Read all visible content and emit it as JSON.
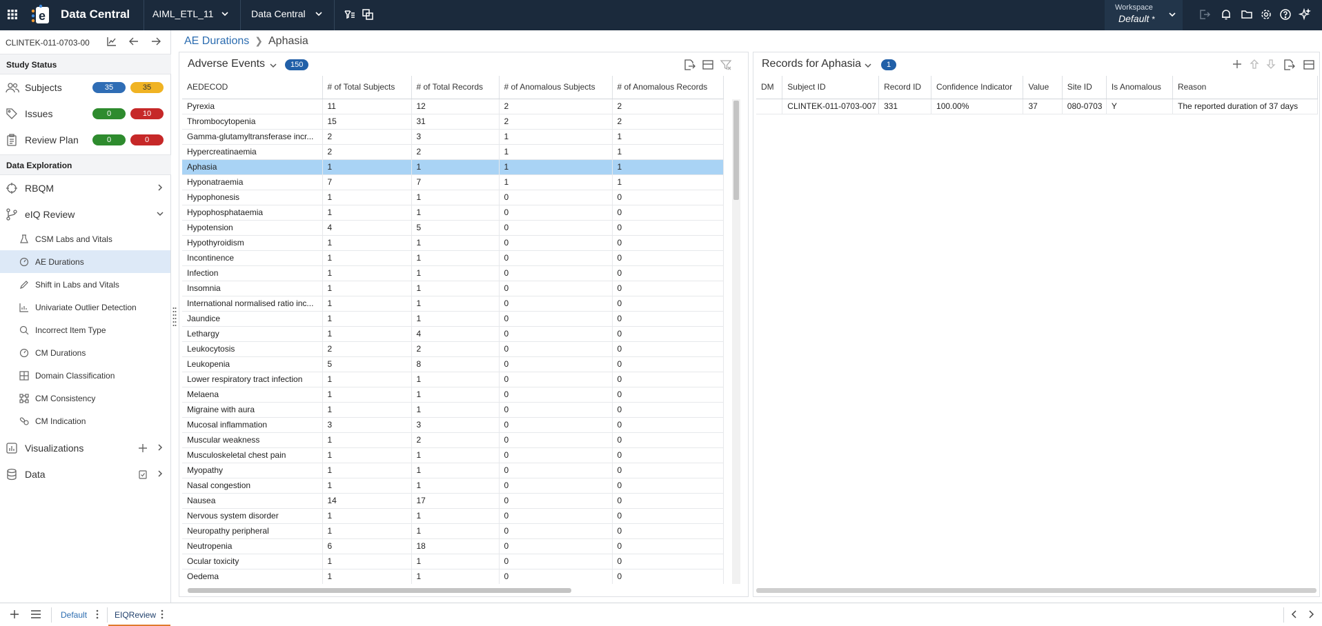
{
  "topbar": {
    "app_title": "Data Central",
    "project": "AIML_ETL_11",
    "module": "Data Central",
    "workspace_label": "Workspace",
    "workspace_value": "Default",
    "workspace_modified": "*"
  },
  "sidebar": {
    "study_id": "CLINTEK-011-0703-00",
    "study_status_header": "Study Status",
    "status_items": [
      {
        "label": "Subjects",
        "left_count": "35",
        "right_count": "35",
        "left_color": "#2f6db5",
        "right_color": "#f0b323"
      },
      {
        "label": "Issues",
        "left_count": "0",
        "right_count": "10",
        "left_color": "#2e8b2e",
        "right_color": "#c62828"
      },
      {
        "label": "Review Plan",
        "left_count": "0",
        "right_count": "0",
        "left_color": "#2e8b2e",
        "right_color": "#c62828"
      }
    ],
    "exploration_header": "Data Exploration",
    "rbqm_label": "RBQM",
    "eiq_label": "eIQ Review",
    "eiq_items": [
      {
        "label": "CSM Labs and Vitals",
        "icon": "flask-icon"
      },
      {
        "label": "AE Durations",
        "icon": "timer-icon"
      },
      {
        "label": "Shift in Labs and Vitals",
        "icon": "pencil-icon"
      },
      {
        "label": "Univariate Outlier Detection",
        "icon": "chart-icon"
      },
      {
        "label": "Incorrect Item Type",
        "icon": "search-icon"
      },
      {
        "label": "CM Durations",
        "icon": "timer-icon"
      },
      {
        "label": "Domain Classification",
        "icon": "grid-icon"
      },
      {
        "label": "CM Consistency",
        "icon": "network-icon"
      },
      {
        "label": "CM Indication",
        "icon": "pills-icon"
      }
    ],
    "active_item": "AE Durations",
    "visualizations_label": "Visualizations",
    "data_label": "Data"
  },
  "breadcrumb": {
    "parent": "AE Durations",
    "current": "Aphasia"
  },
  "left_panel": {
    "title": "Adverse Events",
    "count": "150",
    "columns": [
      "AEDECOD",
      "# of Total Subjects",
      "# of Total Records",
      "# of Anomalous Subjects",
      "# of Anomalous Records"
    ],
    "selected_row": "Aphasia",
    "rows": [
      [
        "Pyrexia",
        "11",
        "12",
        "2",
        "2"
      ],
      [
        "Thrombocytopenia",
        "15",
        "31",
        "2",
        "2"
      ],
      [
        "Gamma-glutamyltransferase incr...",
        "2",
        "3",
        "1",
        "1"
      ],
      [
        "Hypercreatinaemia",
        "2",
        "2",
        "1",
        "1"
      ],
      [
        "Aphasia",
        "1",
        "1",
        "1",
        "1"
      ],
      [
        "Hyponatraemia",
        "7",
        "7",
        "1",
        "1"
      ],
      [
        "Hypophonesis",
        "1",
        "1",
        "0",
        "0"
      ],
      [
        "Hypophosphataemia",
        "1",
        "1",
        "0",
        "0"
      ],
      [
        "Hypotension",
        "4",
        "5",
        "0",
        "0"
      ],
      [
        "Hypothyroidism",
        "1",
        "1",
        "0",
        "0"
      ],
      [
        "Incontinence",
        "1",
        "1",
        "0",
        "0"
      ],
      [
        "Infection",
        "1",
        "1",
        "0",
        "0"
      ],
      [
        "Insomnia",
        "1",
        "1",
        "0",
        "0"
      ],
      [
        "International normalised ratio inc...",
        "1",
        "1",
        "0",
        "0"
      ],
      [
        "Jaundice",
        "1",
        "1",
        "0",
        "0"
      ],
      [
        "Lethargy",
        "1",
        "4",
        "0",
        "0"
      ],
      [
        "Leukocytosis",
        "2",
        "2",
        "0",
        "0"
      ],
      [
        "Leukopenia",
        "5",
        "8",
        "0",
        "0"
      ],
      [
        "Lower respiratory tract infection",
        "1",
        "1",
        "0",
        "0"
      ],
      [
        "Melaena",
        "1",
        "1",
        "0",
        "0"
      ],
      [
        "Migraine with aura",
        "1",
        "1",
        "0",
        "0"
      ],
      [
        "Mucosal inflammation",
        "3",
        "3",
        "0",
        "0"
      ],
      [
        "Muscular weakness",
        "1",
        "2",
        "0",
        "0"
      ],
      [
        "Musculoskeletal chest pain",
        "1",
        "1",
        "0",
        "0"
      ],
      [
        "Myopathy",
        "1",
        "1",
        "0",
        "0"
      ],
      [
        "Nasal congestion",
        "1",
        "1",
        "0",
        "0"
      ],
      [
        "Nausea",
        "14",
        "17",
        "0",
        "0"
      ],
      [
        "Nervous system disorder",
        "1",
        "1",
        "0",
        "0"
      ],
      [
        "Neuropathy peripheral",
        "1",
        "1",
        "0",
        "0"
      ],
      [
        "Neutropenia",
        "6",
        "18",
        "0",
        "0"
      ],
      [
        "Ocular toxicity",
        "1",
        "1",
        "0",
        "0"
      ],
      [
        "Oedema",
        "1",
        "1",
        "0",
        "0"
      ]
    ]
  },
  "right_panel": {
    "title": "Records for Aphasia",
    "count": "1",
    "columns": [
      "DM",
      "Subject ID",
      "Record ID",
      "Confidence Indicator",
      "Value",
      "Site ID",
      "Is Anomalous",
      "Reason"
    ],
    "rows": [
      [
        "",
        "CLINTEK-011-0703-007",
        "331",
        "100.00%",
        "37",
        "080-0703",
        "Y",
        "The reported duration of 37 days"
      ]
    ]
  },
  "bottombar": {
    "tabs": [
      "Default",
      "EIQReview"
    ],
    "active_tab": "EIQReview"
  }
}
